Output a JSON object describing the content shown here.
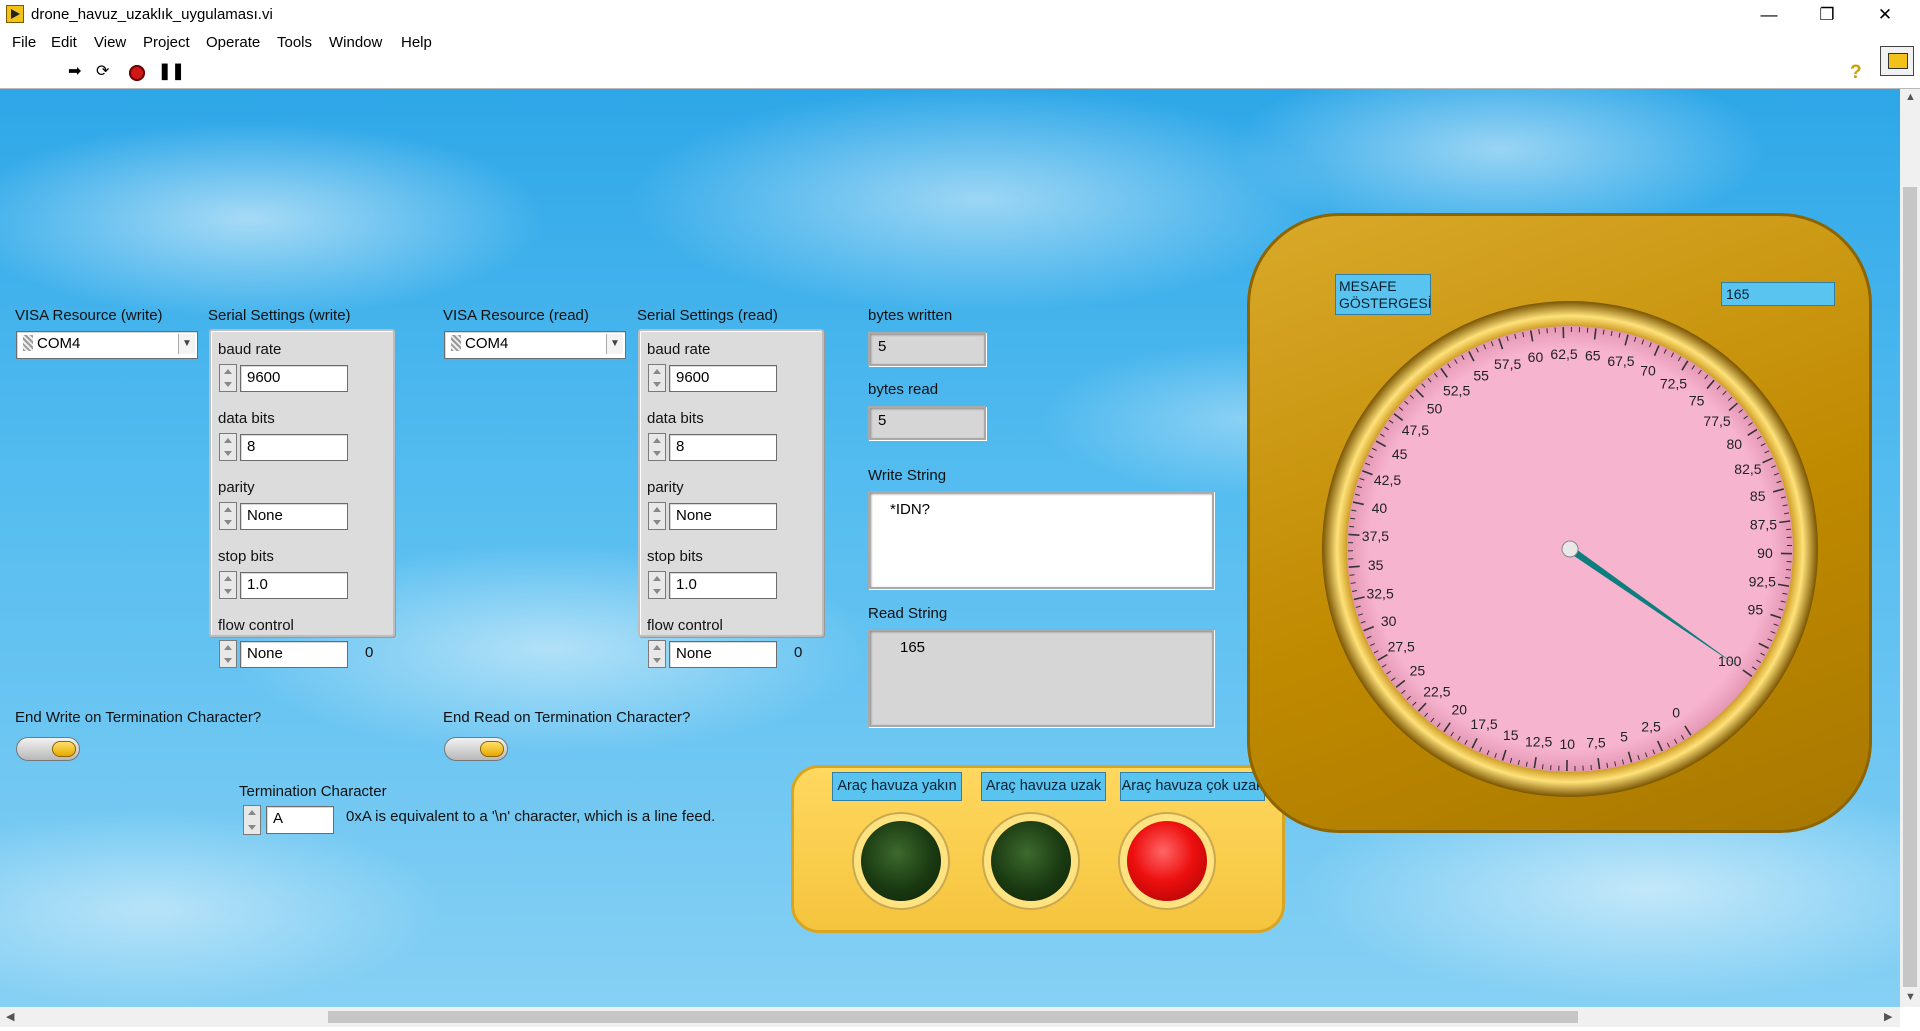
{
  "window": {
    "title": "drone_havuz_uzaklık_uygulaması.vi",
    "minimize_glyph": "—",
    "restore_glyph": "❐",
    "close_glyph": "✕"
  },
  "menu": [
    "File",
    "Edit",
    "View",
    "Project",
    "Operate",
    "Tools",
    "Window",
    "Help"
  ],
  "toolbar": {
    "run_icon": "run-arrow-icon",
    "run_continuously_icon": "run-continuously-icon",
    "abort_icon": "abort-icon",
    "pause_icon": "pause-icon",
    "help_glyph": "?"
  },
  "write_side": {
    "visa_label": "VISA Resource (write)",
    "visa_value": "COM4",
    "serial_label": "Serial Settings (write)",
    "fields": [
      {
        "label": "baud rate",
        "value": "9600"
      },
      {
        "label": "data bits",
        "value": "8"
      },
      {
        "label": "parity",
        "value": "None"
      },
      {
        "label": "stop bits",
        "value": "1.0"
      },
      {
        "label": "flow control",
        "value": "None"
      }
    ],
    "flow_index": "0",
    "end_label": "End Write on Termination Character?"
  },
  "read_side": {
    "visa_label": "VISA Resource (read)",
    "visa_value": "COM4",
    "serial_label": "Serial Settings (read)",
    "fields": [
      {
        "label": "baud rate",
        "value": "9600"
      },
      {
        "label": "data bits",
        "value": "8"
      },
      {
        "label": "parity",
        "value": "None"
      },
      {
        "label": "stop bits",
        "value": "1.0"
      },
      {
        "label": "flow control",
        "value": "None"
      }
    ],
    "flow_index": "0",
    "end_label": "End Read on Termination Character?"
  },
  "termination": {
    "label": "Termination Character",
    "value": "A",
    "note": "0xA is equivalent to a '\\n' character, which is a line feed."
  },
  "io": {
    "bytes_written_label": "bytes written",
    "bytes_written": "5",
    "bytes_read_label": "bytes read",
    "bytes_read": "5",
    "write_string_label": "Write String",
    "write_string": "*IDN?",
    "read_string_label": "Read String",
    "read_string": "165"
  },
  "gauge": {
    "label": "MESAFE GÖSTERGESİ",
    "digital_value": "165",
    "value": 165,
    "min": 0,
    "max": 100,
    "major_step": 2.5,
    "tick_labels": [
      "0",
      "2,5",
      "5",
      "7,5",
      "10",
      "12,5",
      "15",
      "17,5",
      "20",
      "22,5",
      "25",
      "27,5",
      "30",
      "32,5",
      "35",
      "37,5",
      "40",
      "42,5",
      "45",
      "47,5",
      "50",
      "52,5",
      "55",
      "57,5",
      "60",
      "62,5",
      "65",
      "67,5",
      "70",
      "72,5",
      "75",
      "77,5",
      "80",
      "82,5",
      "85",
      "87,5",
      "90",
      "92,5",
      "95",
      "100"
    ],
    "face_color": "#f7b4ce",
    "housing_color": "#c99500",
    "needle_color": "#0d7e7e"
  },
  "lamps": [
    {
      "label": "Araç havuza yakın",
      "state": "off",
      "color": "#1f4214"
    },
    {
      "label": "Araç havuza uzak",
      "state": "off",
      "color": "#1f4214"
    },
    {
      "label": "Araç havuza çok uzak",
      "state": "on",
      "color": "#ee1010"
    }
  ]
}
